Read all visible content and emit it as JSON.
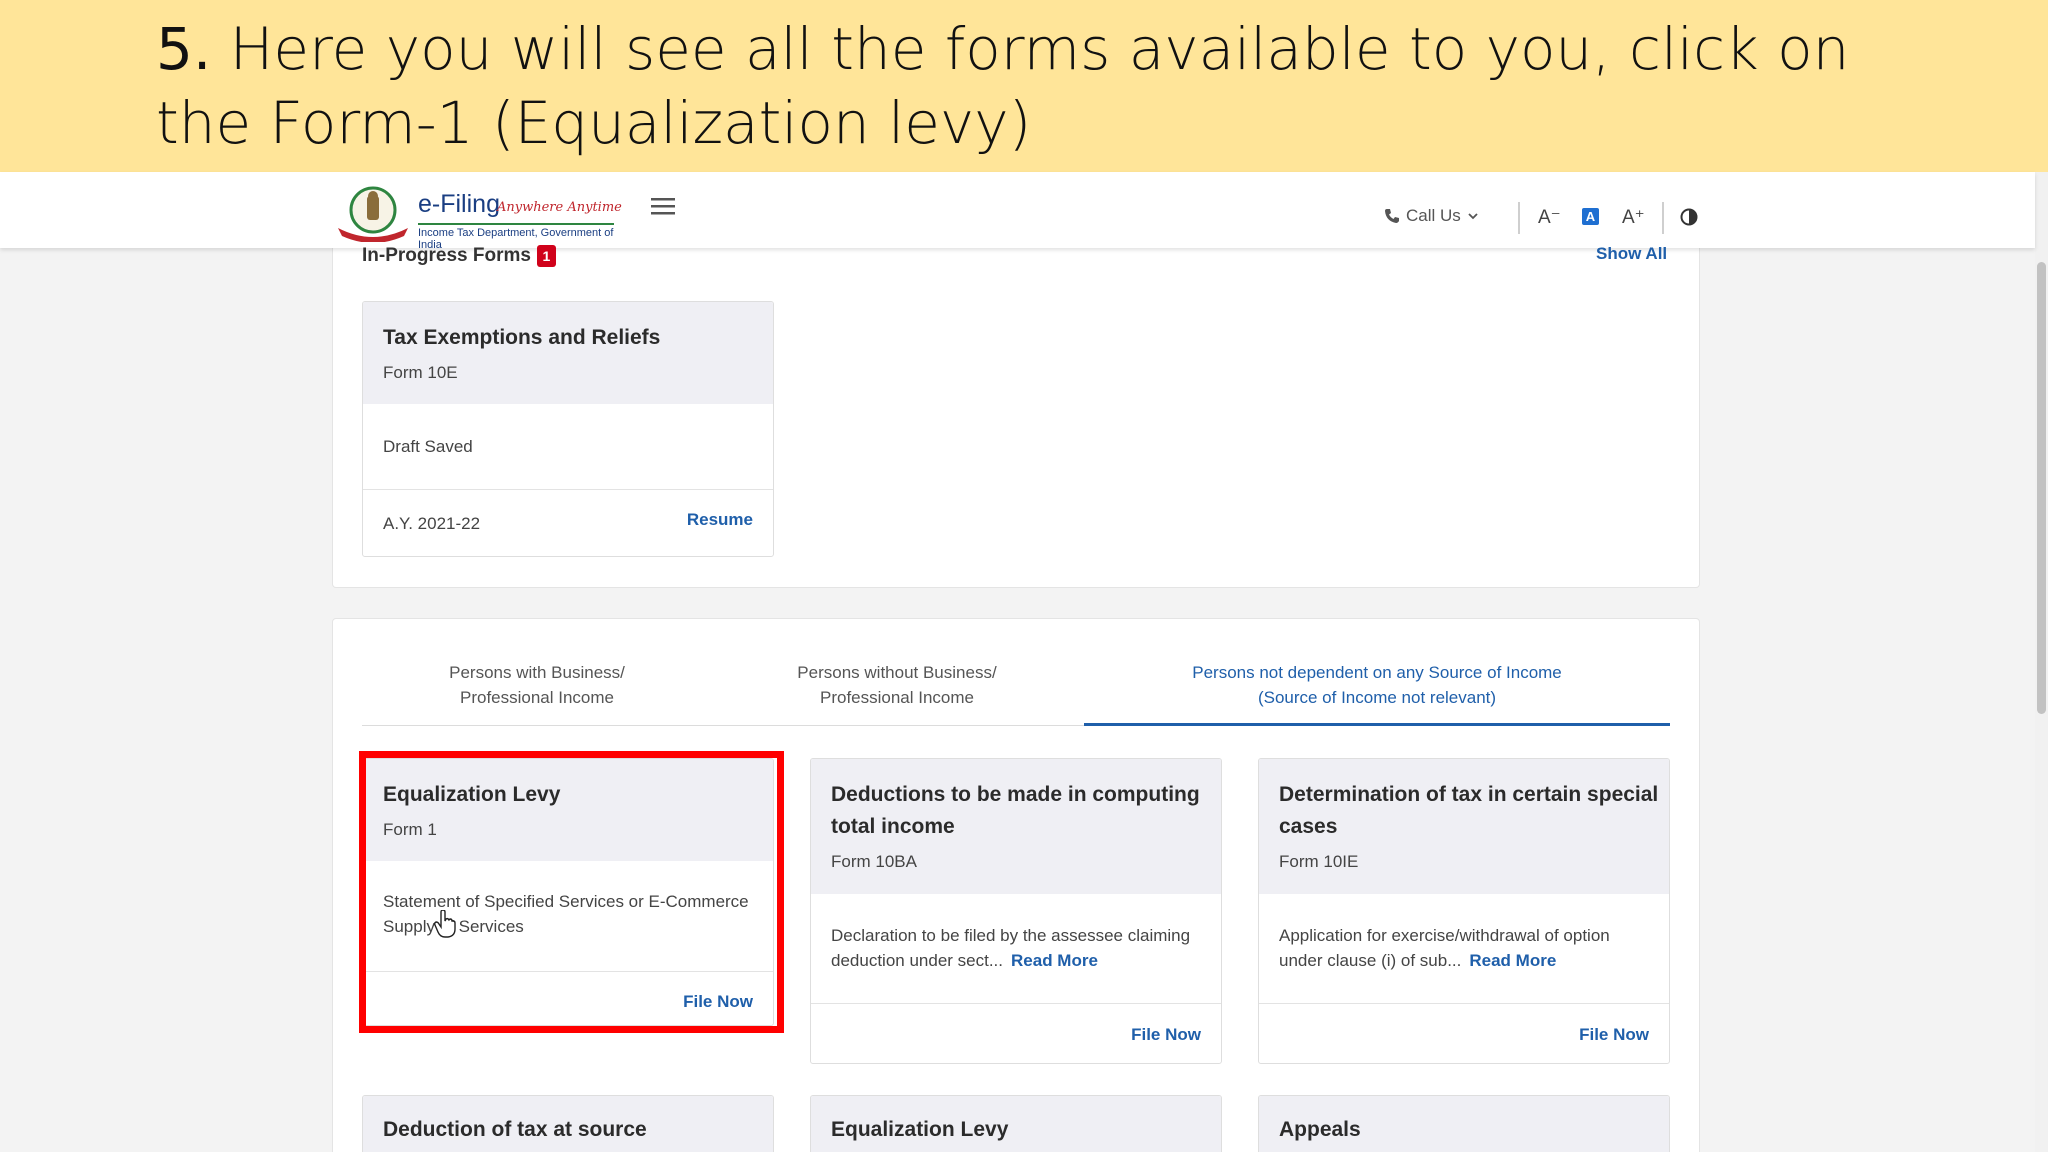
{
  "banner": {
    "step": "5.",
    "text": " Here you will see all the forms available to you, click on the Form-1 (Equalization levy)"
  },
  "header": {
    "logo_title": "e-Filing",
    "logo_tagline": "Anywhere Anytime",
    "logo_sub": "Income Tax Department, Government of India",
    "call_us": "Call Us",
    "font_decrease": "A⁻",
    "font_normal": "A",
    "font_increase": "A⁺"
  },
  "in_progress": {
    "label": "In-Progress Forms",
    "count": "1",
    "show_all": "Show All",
    "card": {
      "title": "Tax Exemptions and Reliefs",
      "form": "Form 10E",
      "status": "Draft Saved",
      "ay": "A.Y. 2021-22",
      "action": "Resume"
    }
  },
  "tabs": [
    {
      "line1": "Persons with Business/",
      "line2": "Professional Income"
    },
    {
      "line1": "Persons without Business/",
      "line2": "Professional Income"
    },
    {
      "line1": "Persons not dependent on any Source of Income",
      "line2": "(Source of Income not relevant)"
    }
  ],
  "forms": [
    {
      "title": "Equalization Levy",
      "form": "Form 1",
      "desc": "Statement of Specified Services or E-Commerce Supply of Services",
      "action": "File Now"
    },
    {
      "title_line1": "Deductions to be made in computing",
      "title_line2": "total income",
      "form": "Form 10BA",
      "desc": "Declaration to be filed by the assessee claiming deduction under sect...",
      "read_more": "Read More",
      "action": "File Now"
    },
    {
      "title_line1": "Determination of tax in certain special",
      "title_line2": "cases",
      "form": "Form 10IE",
      "desc": "Application for exercise/withdrawal of option under clause (i) of sub...",
      "read_more": "Read More",
      "action": "File Now"
    },
    {
      "title": "Deduction of tax at source"
    },
    {
      "title": "Equalization Levy"
    },
    {
      "title": "Appeals"
    }
  ],
  "colors": {
    "banner_bg": "#ffe599",
    "accent": "#1f5faa",
    "highlight": "#ff0000",
    "badge": "#d0021b"
  }
}
